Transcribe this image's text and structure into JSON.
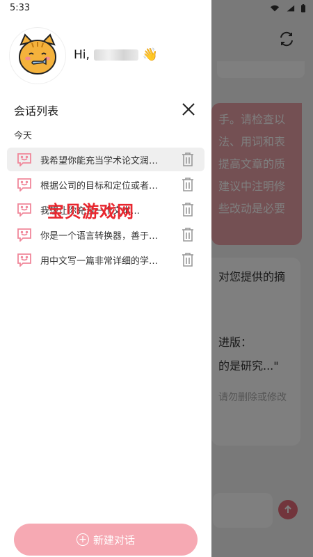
{
  "status": {
    "time": "5:33"
  },
  "drawer": {
    "greeting": "Hi,",
    "wave": "👋",
    "list_title": "会话列表",
    "section_label": "今天",
    "conversations": [
      {
        "text": "我希望你能充当学术论文润…",
        "active": true
      },
      {
        "text": "根据公司的目标和定位或者…",
        "active": false
      },
      {
        "text": "我想让你充当一个文本…",
        "active": false
      },
      {
        "text": "你是一个语言转换器，善于…",
        "active": false
      },
      {
        "text": "用中文写一篇非常详细的学…",
        "active": false
      }
    ],
    "new_button_label": "新建对话",
    "watermark": "宝贝游戏网"
  },
  "background": {
    "pink_bubble_lines": [
      "手。请检查以",
      "法、用词和表",
      "提高文章的质",
      "建议中注明修",
      "些改动是必要"
    ],
    "white_bubble_lines": [
      "对您提供的摘",
      "",
      "进版：",
      "的是研究...\""
    ],
    "white_bubble_hint": "请勿删除或修改"
  },
  "colors": {
    "accent_pink": "#f6a9b3",
    "icon_pink": "#f0879a",
    "bubble_pink": "#e8a1a7",
    "send_red": "#e46b78"
  }
}
